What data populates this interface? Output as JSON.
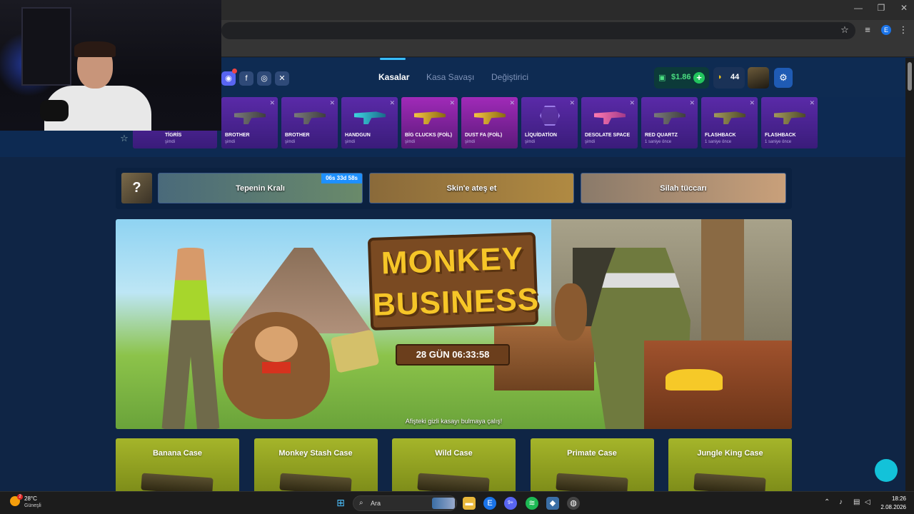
{
  "browser": {
    "window_controls": [
      "—",
      "❐",
      "✕"
    ],
    "profile_letter": "E"
  },
  "site": {
    "nav": [
      {
        "label": "Kasalar",
        "active": true
      },
      {
        "label": "Kasa Savaşı",
        "active": false
      },
      {
        "label": "Değiştirici",
        "active": false
      }
    ],
    "balance": "$1.86",
    "balance_add": "+",
    "bananas": "44",
    "social_icons": [
      "discord-icon",
      "facebook-icon",
      "instagram-icon",
      "x-icon"
    ]
  },
  "live_drops": [
    {
      "name": "TİGRİS",
      "time": "şimdi",
      "style": "purple",
      "gun": "plain"
    },
    {
      "name": "BROTHER",
      "time": "şimdi",
      "style": "purple",
      "gun": "plain"
    },
    {
      "name": "BROTHER",
      "time": "şimdi",
      "style": "purple",
      "gun": "plain"
    },
    {
      "name": "HANDGUN",
      "time": "şimdi",
      "style": "purple",
      "gun": "teal"
    },
    {
      "name": "BİG CLUCKS (FOİL)",
      "time": "şimdi",
      "style": "pink",
      "gun": "sticker"
    },
    {
      "name": "DUST FA (FOİL)",
      "time": "şimdi",
      "style": "pink",
      "gun": "gold"
    },
    {
      "name": "LİQUİDATİON",
      "time": "şimdi",
      "style": "purple",
      "gun": "hex"
    },
    {
      "name": "DESOLATE SPACE",
      "time": "şimdi",
      "style": "purple",
      "gun": "pink"
    },
    {
      "name": "RED QUARTZ",
      "time": "1 saniye önce",
      "style": "purple",
      "gun": "plain"
    },
    {
      "name": "FLASHBACK",
      "time": "1 saniye önce",
      "style": "purple",
      "gun": "camo"
    },
    {
      "name": "FLASHBACK",
      "time": "1 saniye önce",
      "style": "purple",
      "gun": "camo"
    }
  ],
  "events": {
    "mystery": "?",
    "items": [
      {
        "label": "Tepenin Kralı",
        "countdown": "06s 33d 58s"
      },
      {
        "label": "Skin'e ateş et",
        "countdown": ""
      },
      {
        "label": "Silah tüccarı",
        "countdown": ""
      }
    ]
  },
  "hero": {
    "title_line1": "MONKEY",
    "title_line2": "BUSINESS",
    "timer": "28 GÜN 06:33:58",
    "hint": "Afişteki gizli kasayı bulmaya çalış!"
  },
  "cases": [
    {
      "title": "Banana Case"
    },
    {
      "title": "Monkey Stash Case"
    },
    {
      "title": "Wild Case"
    },
    {
      "title": "Primate Case"
    },
    {
      "title": "Jungle King Case"
    }
  ],
  "taskbar": {
    "temp": "28°C",
    "condition": "Güneşli",
    "weather_badge": "2",
    "search_label": "Ara",
    "time": "18:26",
    "date": "2.08.2026",
    "chrome_badge": "E",
    "discord_badge": "9+"
  },
  "colors": {
    "page_bg": "#0f2545",
    "accent": "#38bdf8",
    "balance_green": "#4ade80",
    "drop_purple": "#5a2aa8",
    "drop_pink": "#a02ab8",
    "case_green": "#a5b52a"
  }
}
